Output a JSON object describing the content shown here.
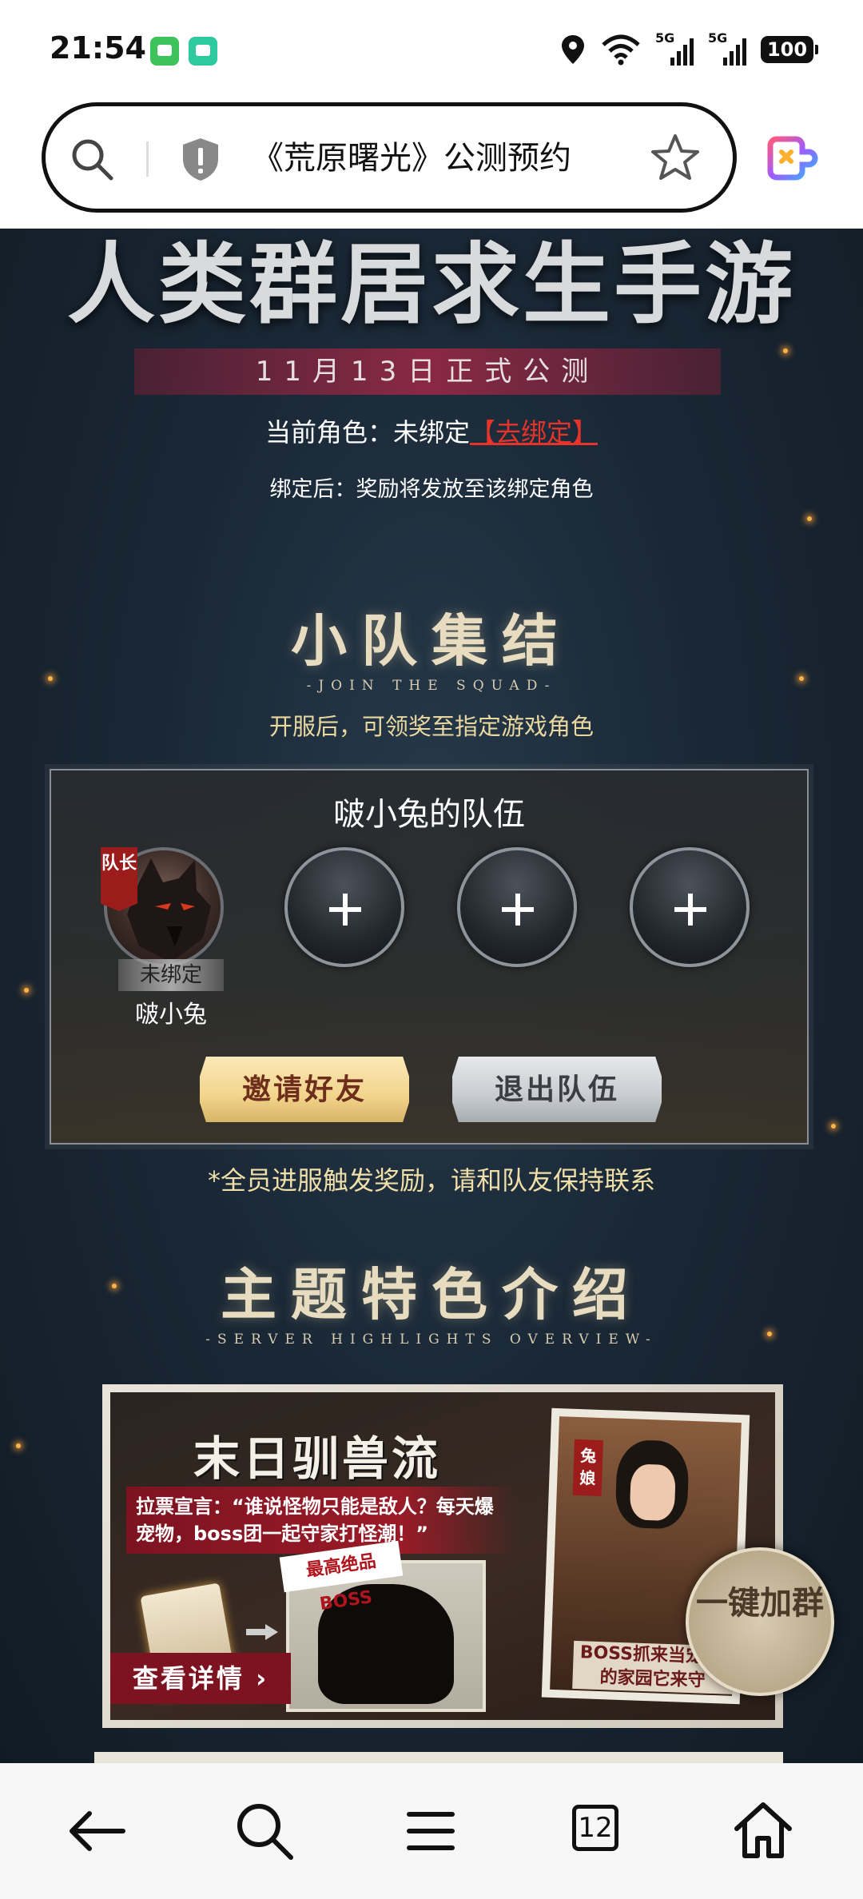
{
  "status_bar": {
    "time": "21:54",
    "signal1_label": "5G",
    "signal2_label": "5G",
    "battery": "100"
  },
  "address_bar": {
    "title": "《荒原曙光》公测预约"
  },
  "page": {
    "hero_title": "人类群居求生手游",
    "date_banner": "11月13日正式公测",
    "role_prefix": "当前角色：未绑定",
    "role_link": "【去绑定】",
    "role_note": "绑定后：奖励将发放至该绑定角色",
    "squad_section": {
      "title": "小队集结",
      "subtitle": "-JOIN THE SQUAD-",
      "desc": "开服后，可领奖至指定游戏角色",
      "team_name": "啵小兔的队伍",
      "leader_tag": "队长",
      "leader_status": "未绑定",
      "leader_name": "啵小兔",
      "invite_button": "邀请好友",
      "quit_button": "退出队伍",
      "note": "*全员进服触发奖励，请和队友保持联系"
    },
    "feature_section": {
      "title": "主题特色介绍",
      "subtitle": "-SERVER HIGHLIGHTS OVERVIEW-",
      "card_title": "末日驯兽流",
      "quote": "拉票宣言：“谁说怪物只能是敌人？每天爆宠物，boss团一起守家打怪潮！”",
      "boss_badge": "最高绝品BOSS",
      "detail_button": "查看详情 ›",
      "photo_tag": "兔娘",
      "photo_caption": "BOSS抓来当宠 你的家园它来守",
      "join_group": "一键加群"
    }
  },
  "bottom_nav": {
    "tabs_count": "12"
  }
}
